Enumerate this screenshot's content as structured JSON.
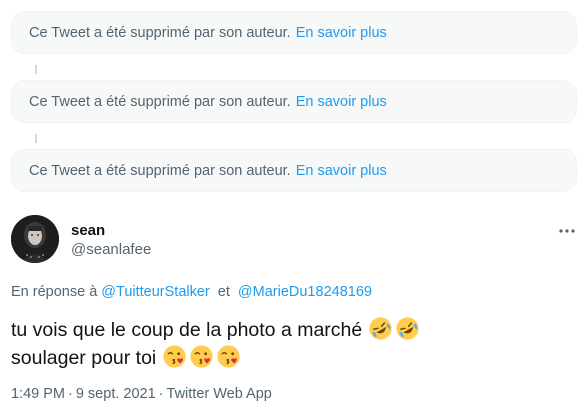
{
  "deleted_tweets": [
    {
      "message": "Ce Tweet a été supprimé par son auteur.",
      "link": "En savoir plus"
    },
    {
      "message": "Ce Tweet a été supprimé par son auteur.",
      "link": "En savoir plus"
    },
    {
      "message": "Ce Tweet a été supprimé par son auteur.",
      "link": "En savoir plus"
    }
  ],
  "tweet": {
    "author_name": "sean",
    "author_handle": "@seanlafee",
    "reply_prefix": "En réponse à",
    "reply_mentions": [
      "@TuitteurStalker",
      "@MarieDu18248169"
    ],
    "reply_joiner": "et",
    "text_line1": "tu vois que le coup de la photo a marché",
    "text_line2": "soulager pour toi",
    "emojis_line1": [
      "rolling-on-floor-laughing-icon",
      "rolling-on-floor-laughing-icon"
    ],
    "emojis_line2": [
      "face-blowing-kiss-icon",
      "face-blowing-kiss-icon",
      "face-blowing-kiss-icon"
    ],
    "time": "1:49 PM",
    "date": "9 sept. 2021",
    "separator": "·",
    "source": "Twitter Web App"
  },
  "colors": {
    "link": "#1d9bf0",
    "muted": "#536471",
    "text": "#0f1419",
    "deleted_bg": "#f7f9f9",
    "thread_line": "#cfd9de"
  }
}
